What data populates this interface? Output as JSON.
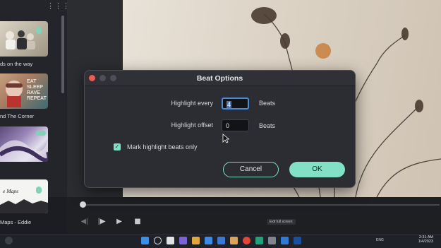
{
  "dialog": {
    "title": "Beat Options",
    "highlight_every_label": "Highlight every",
    "highlight_every_value": "4",
    "highlight_every_unit": "Beats",
    "highlight_offset_label": "Highlight offset",
    "highlight_offset_value": "0",
    "highlight_offset_unit": "Beats",
    "mark_highlight_label": "Mark highlight beats only",
    "mark_highlight_checked": true,
    "cancel_label": "Cancel",
    "ok_label": "OK"
  },
  "library": {
    "items": [
      {
        "label": "ds on the way"
      },
      {
        "label": "nd The Corner",
        "thumb_text": "EAT\nSLEEP\nRAVE\nREPEAT"
      },
      {
        "label": ""
      },
      {
        "label": "Maps - Eddie",
        "thumb_text": "e Maps"
      }
    ]
  },
  "player": {
    "tooltip": "Exit full screen"
  },
  "taskbar": {
    "tray_text": "ENG",
    "time": "2:31 AM",
    "date": "1/4/2023"
  },
  "colors": {
    "accent": "#82e0c4",
    "dialog_bg": "#2b2d33",
    "close_button": "#ee5b55",
    "focus_ring": "#4c8bd6"
  }
}
